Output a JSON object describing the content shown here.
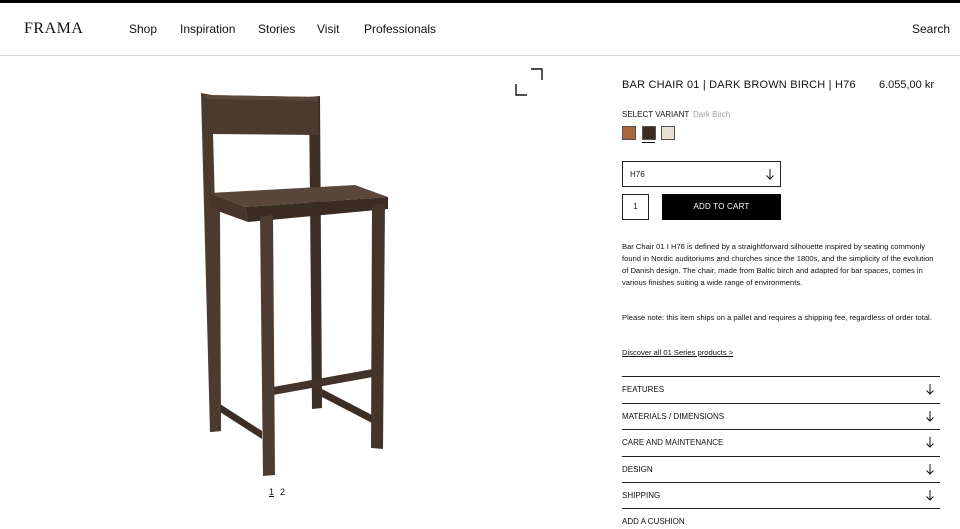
{
  "header": {
    "logo": "FRAMA",
    "nav": [
      "Shop",
      "Inspiration",
      "Stories",
      "Visit",
      "Professionals"
    ],
    "search": "Search"
  },
  "gallery": {
    "pages": [
      "1",
      "2"
    ],
    "active_page": "1",
    "icon": "expand-icon"
  },
  "product": {
    "title": "BAR CHAIR 01 | DARK BROWN BIRCH | H76",
    "price": "6.055,00 kr",
    "variant_label": "SELECT VARIANT",
    "variant_value": "Dark Birch",
    "swatches": [
      {
        "name": "light-brown",
        "color": "#a9683b"
      },
      {
        "name": "dark-birch",
        "color": "#3b2a20"
      },
      {
        "name": "natural",
        "color": "#e9dfd0"
      }
    ],
    "selected_swatch": "dark-birch",
    "height_select": "H76",
    "quantity": "1",
    "add_to_cart": "ADD TO CART",
    "description": "Bar Chair 01 I H76 is defined by a straightforward silhouette inspired by seating commonly found in Nordic auditoriums and churches since the 1800s, and the simplicity of the evolution of Danish design. The chair, made from Baltic birch and adapted for bar spaces, comes in various finishes suiting a wide range of environments.",
    "note": "Please note: this item ships on a pallet and requires a shipping fee, regardless of order total.",
    "discover_link": "Discover all 01 Series products >",
    "accordion": [
      "FEATURES",
      "MATERIALS / DIMENSIONS",
      "CARE AND MAINTENANCE",
      "DESIGN",
      "SHIPPING",
      "ADD A CUSHION"
    ]
  },
  "colors": {
    "chair_wood": "#4a3a30",
    "chair_dark": "#35271f",
    "accent": "#000000"
  }
}
